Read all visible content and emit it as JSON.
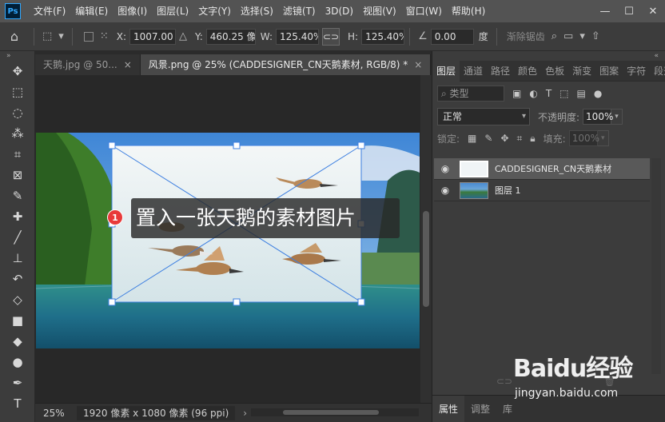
{
  "app": {
    "logo": "Ps"
  },
  "menu": [
    "文件(F)",
    "编辑(E)",
    "图像(I)",
    "图层(L)",
    "文字(Y)",
    "选择(S)",
    "滤镜(T)",
    "3D(D)",
    "视图(V)",
    "窗口(W)",
    "帮助(H)"
  ],
  "window_controls": {
    "minimize": "—",
    "maximize": "☐",
    "close": "✕"
  },
  "options": {
    "x_label": "X:",
    "x_value": "1007.00 像",
    "y_label": "Y:",
    "y_value": "460.25 像素",
    "w_label": "W:",
    "w_value": "125.40%",
    "h_label": "H:",
    "h_value": "125.40%",
    "angle_value": "0.00",
    "angle_unit": "度",
    "interp_label": "渐除锯齿"
  },
  "tabs": [
    {
      "label": "天鹅.jpg @ 50...",
      "close": "×"
    },
    {
      "label": "风景.png @ 25% (CADDESIGNER_CN天鹅素材, RGB/8) *",
      "close": "×"
    }
  ],
  "callout": {
    "number": "1",
    "text": "置入一张天鹅的素材图片"
  },
  "status": {
    "zoom": "25%",
    "doc_info": "1920 像素 x 1080 像素 (96 ppi)",
    "arrow": "›"
  },
  "panel": {
    "tabs": [
      "图层",
      "通道",
      "路径",
      "颜色",
      "色板",
      "渐变",
      "图案",
      "字符",
      "段落"
    ],
    "menu_icon": "≡",
    "filter_kind": "类型",
    "blend_mode": "正常",
    "opacity_label": "不透明度:",
    "opacity_value": "100%",
    "lock_label": "锁定:",
    "fill_label": "填充:",
    "fill_value": "100%",
    "layers": [
      {
        "name": "CADDESIGNER_CN天鹅素材",
        "selected": true
      },
      {
        "name": "图层 1",
        "selected": false
      }
    ],
    "bottom_tabs": [
      "属性",
      "调整",
      "库"
    ]
  },
  "watermark": {
    "logo": "Baidu经验",
    "url": "jingyan.baidu.com"
  }
}
